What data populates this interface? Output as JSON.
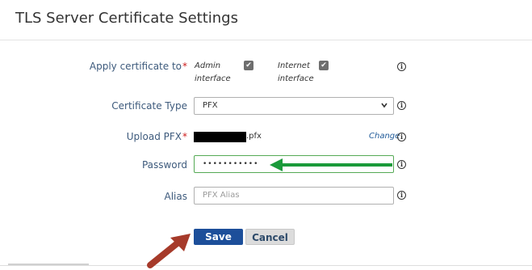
{
  "page": {
    "title": "TLS Server Certificate Settings"
  },
  "form": {
    "apply_to": {
      "label": "Apply certificate to",
      "required_mark": "*",
      "options": [
        {
          "line1": "Admin",
          "line2": "interface",
          "checked": true,
          "check_glyph": "✔"
        },
        {
          "line1": "Internet",
          "line2": "interface",
          "checked": true,
          "check_glyph": "✔"
        }
      ]
    },
    "certificate_type": {
      "label": "Certificate Type",
      "value": "PFX"
    },
    "upload": {
      "label": "Upload PFX",
      "required_mark": "*",
      "file_extension": ".pfx",
      "change_link": "Change"
    },
    "password": {
      "label": "Password",
      "value": "•••••••••••"
    },
    "alias": {
      "label": "Alias",
      "placeholder": "PFX Alias"
    },
    "info_glyph": "i"
  },
  "actions": {
    "save_label": "Save",
    "cancel_label": "Cancel"
  },
  "annotations": {
    "green_arrow_color": "#1a9a3a",
    "red_arrow_color": "#a63a2a"
  }
}
